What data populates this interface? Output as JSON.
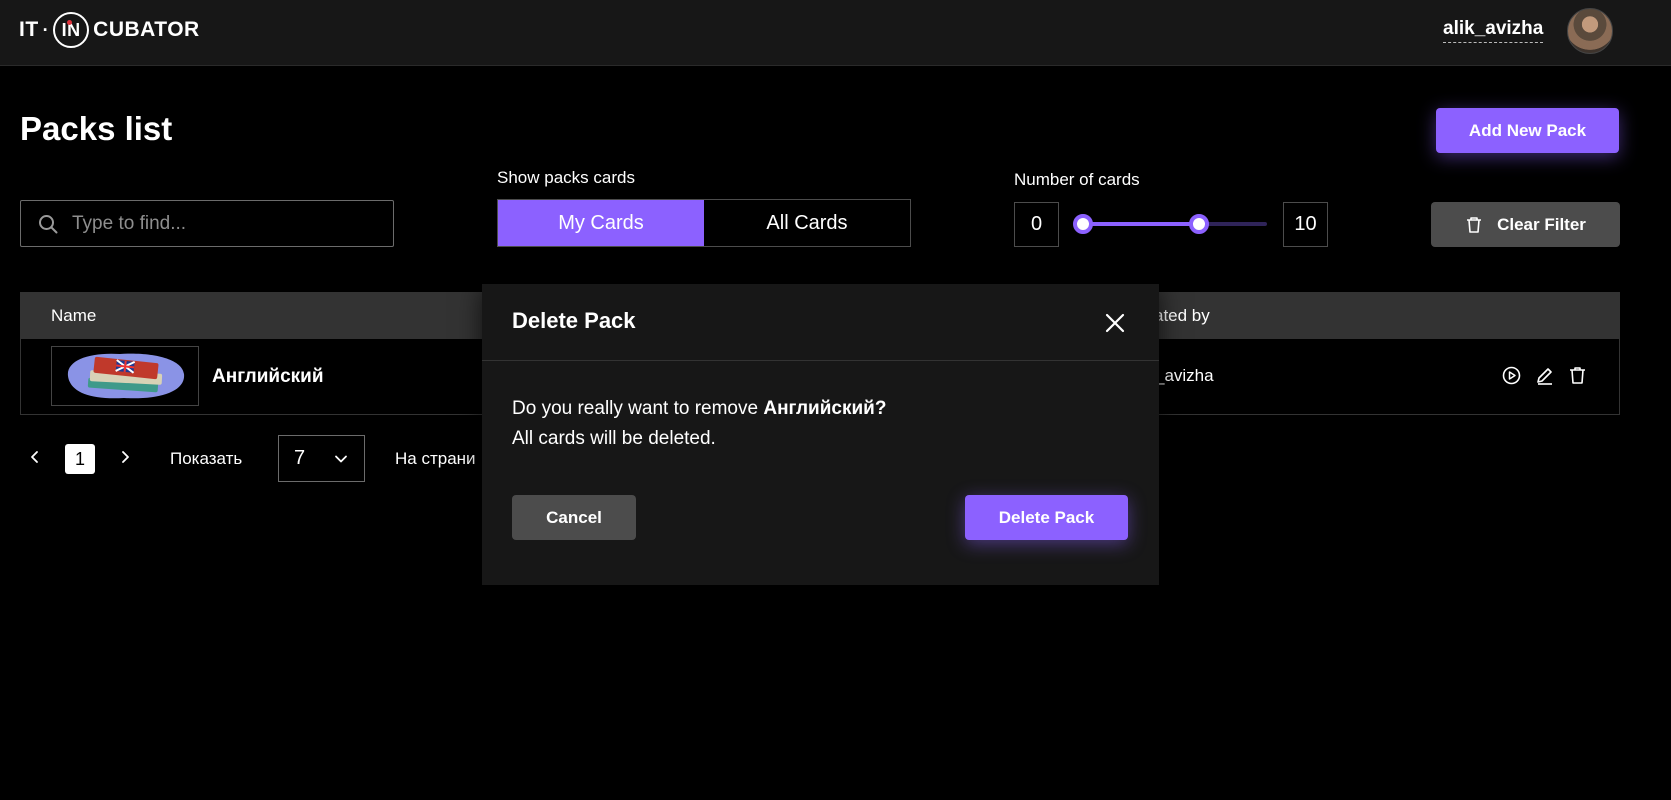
{
  "header": {
    "logo_left": "IT",
    "logo_dot": "·",
    "logo_in": "IN",
    "logo_right": "CUBATOR",
    "username": "alik_avizha"
  },
  "page": {
    "title": "Packs list",
    "add_button": "Add New Pack"
  },
  "filters": {
    "search_placeholder": "Type to find...",
    "show_label": "Show packs cards",
    "my_cards": "My Cards",
    "all_cards": "All Cards",
    "number_label": "Number of cards",
    "min_value": "0",
    "max_value": "10",
    "slider_min_fraction": 0,
    "slider_max_fraction": 0.63,
    "clear_filter": "Clear Filter"
  },
  "table": {
    "col_name": "Name",
    "col_created": "ated by",
    "rows": [
      {
        "name": "Английский",
        "created_by": "_avizha"
      }
    ]
  },
  "pagination": {
    "current_page": "1",
    "show_label": "Показать",
    "per_page_value": "7",
    "per_page_suffix": "На страни"
  },
  "modal": {
    "title": "Delete Pack",
    "text_prefix": "Do you really want to remove ",
    "pack_name": "Английский?",
    "text_line2": "All cards will be deleted.",
    "cancel": "Cancel",
    "confirm": "Delete Pack"
  },
  "colors": {
    "accent": "#8c61ff",
    "background": "#000000",
    "surface": "#171717",
    "button_secondary": "#4c4c4c"
  }
}
